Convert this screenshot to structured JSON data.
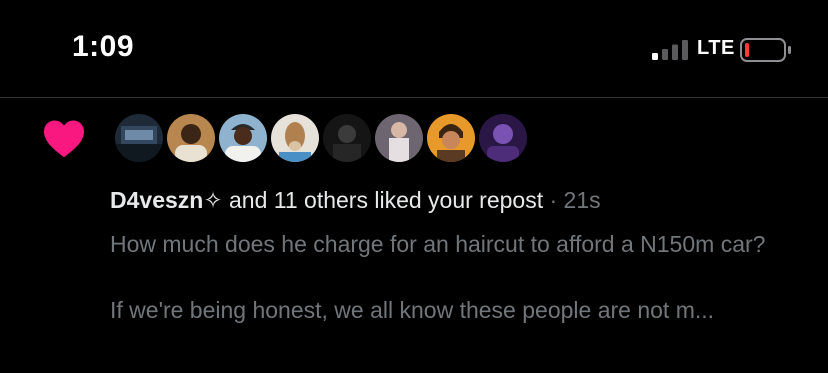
{
  "status_bar": {
    "time": "1:09",
    "network": "LTE",
    "signal_icon": "cellular-signal-icon",
    "battery_icon": "battery-low-icon",
    "battery_level": 0.1,
    "battery_color": "#ff3b30"
  },
  "notification": {
    "icon": "heart-icon",
    "icon_color": "#f91880",
    "avatars": [
      {
        "icon": "avatar-1"
      },
      {
        "icon": "avatar-2"
      },
      {
        "icon": "avatar-3"
      },
      {
        "icon": "avatar-4"
      },
      {
        "icon": "avatar-5"
      },
      {
        "icon": "avatar-6"
      },
      {
        "icon": "avatar-7"
      },
      {
        "icon": "avatar-8"
      }
    ],
    "username": "D4veszn✧",
    "action_text": " and 11 others liked your repost",
    "separator": " · ",
    "time_ago": "21s",
    "preview_line1": "How much does he charge for an haircut to afford a N150m car?",
    "preview_line2": "If we're being honest, we all know these people are not m..."
  }
}
